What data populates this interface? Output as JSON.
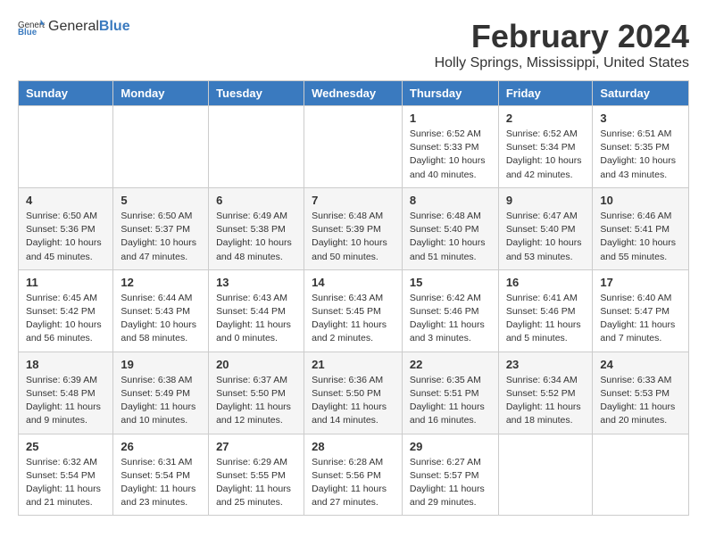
{
  "logo": {
    "text_general": "General",
    "text_blue": "Blue"
  },
  "title": "February 2024",
  "subtitle": "Holly Springs, Mississippi, United States",
  "days_of_week": [
    "Sunday",
    "Monday",
    "Tuesday",
    "Wednesday",
    "Thursday",
    "Friday",
    "Saturday"
  ],
  "weeks": [
    [
      {
        "day": "",
        "info": ""
      },
      {
        "day": "",
        "info": ""
      },
      {
        "day": "",
        "info": ""
      },
      {
        "day": "",
        "info": ""
      },
      {
        "day": "1",
        "info": "Sunrise: 6:52 AM\nSunset: 5:33 PM\nDaylight: 10 hours\nand 40 minutes."
      },
      {
        "day": "2",
        "info": "Sunrise: 6:52 AM\nSunset: 5:34 PM\nDaylight: 10 hours\nand 42 minutes."
      },
      {
        "day": "3",
        "info": "Sunrise: 6:51 AM\nSunset: 5:35 PM\nDaylight: 10 hours\nand 43 minutes."
      }
    ],
    [
      {
        "day": "4",
        "info": "Sunrise: 6:50 AM\nSunset: 5:36 PM\nDaylight: 10 hours\nand 45 minutes."
      },
      {
        "day": "5",
        "info": "Sunrise: 6:50 AM\nSunset: 5:37 PM\nDaylight: 10 hours\nand 47 minutes."
      },
      {
        "day": "6",
        "info": "Sunrise: 6:49 AM\nSunset: 5:38 PM\nDaylight: 10 hours\nand 48 minutes."
      },
      {
        "day": "7",
        "info": "Sunrise: 6:48 AM\nSunset: 5:39 PM\nDaylight: 10 hours\nand 50 minutes."
      },
      {
        "day": "8",
        "info": "Sunrise: 6:48 AM\nSunset: 5:40 PM\nDaylight: 10 hours\nand 51 minutes."
      },
      {
        "day": "9",
        "info": "Sunrise: 6:47 AM\nSunset: 5:40 PM\nDaylight: 10 hours\nand 53 minutes."
      },
      {
        "day": "10",
        "info": "Sunrise: 6:46 AM\nSunset: 5:41 PM\nDaylight: 10 hours\nand 55 minutes."
      }
    ],
    [
      {
        "day": "11",
        "info": "Sunrise: 6:45 AM\nSunset: 5:42 PM\nDaylight: 10 hours\nand 56 minutes."
      },
      {
        "day": "12",
        "info": "Sunrise: 6:44 AM\nSunset: 5:43 PM\nDaylight: 10 hours\nand 58 minutes."
      },
      {
        "day": "13",
        "info": "Sunrise: 6:43 AM\nSunset: 5:44 PM\nDaylight: 11 hours\nand 0 minutes."
      },
      {
        "day": "14",
        "info": "Sunrise: 6:43 AM\nSunset: 5:45 PM\nDaylight: 11 hours\nand 2 minutes."
      },
      {
        "day": "15",
        "info": "Sunrise: 6:42 AM\nSunset: 5:46 PM\nDaylight: 11 hours\nand 3 minutes."
      },
      {
        "day": "16",
        "info": "Sunrise: 6:41 AM\nSunset: 5:46 PM\nDaylight: 11 hours\nand 5 minutes."
      },
      {
        "day": "17",
        "info": "Sunrise: 6:40 AM\nSunset: 5:47 PM\nDaylight: 11 hours\nand 7 minutes."
      }
    ],
    [
      {
        "day": "18",
        "info": "Sunrise: 6:39 AM\nSunset: 5:48 PM\nDaylight: 11 hours\nand 9 minutes."
      },
      {
        "day": "19",
        "info": "Sunrise: 6:38 AM\nSunset: 5:49 PM\nDaylight: 11 hours\nand 10 minutes."
      },
      {
        "day": "20",
        "info": "Sunrise: 6:37 AM\nSunset: 5:50 PM\nDaylight: 11 hours\nand 12 minutes."
      },
      {
        "day": "21",
        "info": "Sunrise: 6:36 AM\nSunset: 5:50 PM\nDaylight: 11 hours\nand 14 minutes."
      },
      {
        "day": "22",
        "info": "Sunrise: 6:35 AM\nSunset: 5:51 PM\nDaylight: 11 hours\nand 16 minutes."
      },
      {
        "day": "23",
        "info": "Sunrise: 6:34 AM\nSunset: 5:52 PM\nDaylight: 11 hours\nand 18 minutes."
      },
      {
        "day": "24",
        "info": "Sunrise: 6:33 AM\nSunset: 5:53 PM\nDaylight: 11 hours\nand 20 minutes."
      }
    ],
    [
      {
        "day": "25",
        "info": "Sunrise: 6:32 AM\nSunset: 5:54 PM\nDaylight: 11 hours\nand 21 minutes."
      },
      {
        "day": "26",
        "info": "Sunrise: 6:31 AM\nSunset: 5:54 PM\nDaylight: 11 hours\nand 23 minutes."
      },
      {
        "day": "27",
        "info": "Sunrise: 6:29 AM\nSunset: 5:55 PM\nDaylight: 11 hours\nand 25 minutes."
      },
      {
        "day": "28",
        "info": "Sunrise: 6:28 AM\nSunset: 5:56 PM\nDaylight: 11 hours\nand 27 minutes."
      },
      {
        "day": "29",
        "info": "Sunrise: 6:27 AM\nSunset: 5:57 PM\nDaylight: 11 hours\nand 29 minutes."
      },
      {
        "day": "",
        "info": ""
      },
      {
        "day": "",
        "info": ""
      }
    ]
  ]
}
